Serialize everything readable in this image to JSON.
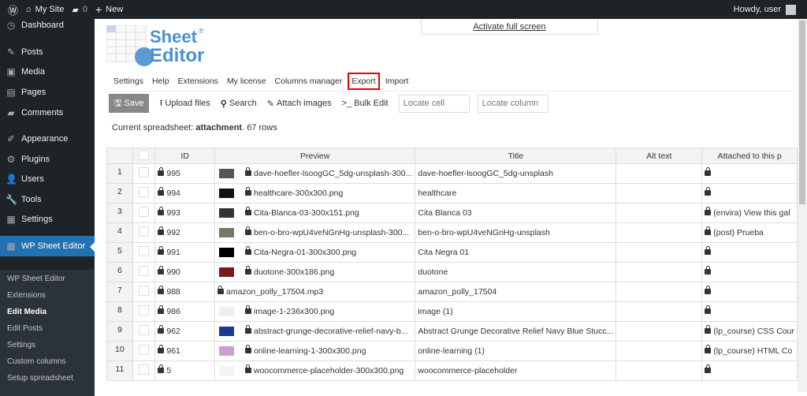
{
  "adminbar": {
    "site": "My Site",
    "comments": "0",
    "new": "New",
    "howdy": "Howdy, user"
  },
  "sidebar": {
    "items": [
      "Dashboard",
      "Posts",
      "Media",
      "Pages",
      "Comments",
      "Appearance",
      "Plugins",
      "Users",
      "Tools",
      "Settings",
      "WP Sheet Editor"
    ],
    "submenu": [
      "WP Sheet Editor",
      "Extensions",
      "Edit Media",
      "Edit Posts",
      "Settings",
      "Custom columns",
      "Setup spreadsheet"
    ]
  },
  "logo": {
    "line1": "Sheet",
    "line2": "Editor",
    "reg": "®"
  },
  "fullscreen": "Activate full screen",
  "tabs": [
    "Settings",
    "Help",
    "Extensions",
    "My license",
    "Columns manager",
    "Export",
    "Import"
  ],
  "toolbar": {
    "save": "Save",
    "upload": "Upload files",
    "search": "Search",
    "attach": "Attach images",
    "bulk": "Bulk Edit",
    "locate_cell": "Locate cell",
    "locate_column": "Locate column"
  },
  "status": {
    "prefix": "Current spreadsheet: ",
    "type": "attachment",
    "suffix": ". 67 rows"
  },
  "columns": [
    "ID",
    "Preview",
    "Title",
    "Alt text",
    "Attached to this p"
  ],
  "rows": [
    {
      "n": "1",
      "id": "995",
      "file": "dave-hoefler-lsoogGC_5dg-unsplash-300...",
      "title": "dave-hoefler-lsoogGC_5dg-unsplash",
      "alt": "",
      "att": "",
      "thumb": "#555"
    },
    {
      "n": "2",
      "id": "994",
      "file": "healthcare-300x300.png",
      "title": "healthcare",
      "alt": "",
      "att": "",
      "thumb": "#111"
    },
    {
      "n": "3",
      "id": "993",
      "file": "Cita-Blanca-03-300x151.png",
      "title": "Cita Blanca 03",
      "alt": "",
      "att": "(envira) View this gal",
      "thumb": "#333"
    },
    {
      "n": "4",
      "id": "992",
      "file": "ben-o-bro-wpU4veNGnHg-unsplash-300...",
      "title": "ben-o-bro-wpU4veNGnHg-unsplash",
      "alt": "",
      "att": "(post) Prueba",
      "thumb": "#776"
    },
    {
      "n": "5",
      "id": "991",
      "file": "Cita-Negra-01-300x300.png",
      "title": "Cita Negra 01",
      "alt": "",
      "att": "",
      "thumb": "#000"
    },
    {
      "n": "6",
      "id": "990",
      "file": "duotone-300x186.png",
      "title": "duotone",
      "alt": "",
      "att": "",
      "thumb": "#7a1a1a"
    },
    {
      "n": "7",
      "id": "988",
      "file": "amazon_polly_17504.mp3",
      "title": "amazon_polly_17504",
      "alt": "",
      "att": "",
      "thumb": ""
    },
    {
      "n": "8",
      "id": "986",
      "file": "image-1-236x300.png",
      "title": "image (1)",
      "alt": "",
      "att": "",
      "thumb": "#eee"
    },
    {
      "n": "9",
      "id": "962",
      "file": "abstract-grunge-decorative-relief-navy-b...",
      "title": "Abstract Grunge Decorative Relief Navy Blue Stucc...",
      "alt": "",
      "att": "(lp_course) CSS Cour",
      "thumb": "#1a3a8a"
    },
    {
      "n": "10",
      "id": "961",
      "file": "online-learning-1-300x300.png",
      "title": "online-learning (1)",
      "alt": "",
      "att": "(lp_course) HTML Co",
      "thumb": "#c9a0d0"
    },
    {
      "n": "11",
      "id": "5",
      "file": "woocommerce-placeholder-300x300.png",
      "title": "woocommerce-placeholder",
      "alt": "",
      "att": "",
      "thumb": "#f4f4f4"
    }
  ]
}
